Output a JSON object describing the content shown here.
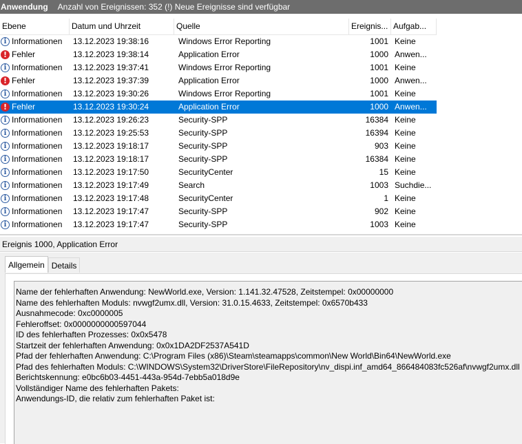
{
  "titlebar": {
    "app": "Anwendung",
    "info": "Anzahl von Ereignissen: 352 (!) Neue Ereignisse sind verfügbar"
  },
  "columns": [
    "Ebene",
    "Datum und Uhrzeit",
    "Quelle",
    "Ereignis...",
    "Aufgab..."
  ],
  "rows": [
    {
      "level": "Informationen",
      "icon": "info-icon",
      "datetime": "13.12.2023 19:38:16",
      "source": "Windows Error Reporting",
      "id": "1001",
      "task": "Keine"
    },
    {
      "level": "Fehler",
      "icon": "error-icon",
      "datetime": "13.12.2023 19:38:14",
      "source": "Application Error",
      "id": "1000",
      "task": "Anwen..."
    },
    {
      "level": "Informationen",
      "icon": "info-icon",
      "datetime": "13.12.2023 19:37:41",
      "source": "Windows Error Reporting",
      "id": "1001",
      "task": "Keine"
    },
    {
      "level": "Fehler",
      "icon": "error-icon",
      "datetime": "13.12.2023 19:37:39",
      "source": "Application Error",
      "id": "1000",
      "task": "Anwen..."
    },
    {
      "level": "Informationen",
      "icon": "info-icon",
      "datetime": "13.12.2023 19:30:26",
      "source": "Windows Error Reporting",
      "id": "1001",
      "task": "Keine"
    },
    {
      "level": "Fehler",
      "icon": "error-icon",
      "datetime": "13.12.2023 19:30:24",
      "source": "Application Error",
      "id": "1000",
      "task": "Anwen...",
      "selected": true
    },
    {
      "level": "Informationen",
      "icon": "info-icon",
      "datetime": "13.12.2023 19:26:23",
      "source": "Security-SPP",
      "id": "16384",
      "task": "Keine"
    },
    {
      "level": "Informationen",
      "icon": "info-icon",
      "datetime": "13.12.2023 19:25:53",
      "source": "Security-SPP",
      "id": "16394",
      "task": "Keine"
    },
    {
      "level": "Informationen",
      "icon": "info-icon",
      "datetime": "13.12.2023 19:18:17",
      "source": "Security-SPP",
      "id": "903",
      "task": "Keine"
    },
    {
      "level": "Informationen",
      "icon": "info-icon",
      "datetime": "13.12.2023 19:18:17",
      "source": "Security-SPP",
      "id": "16384",
      "task": "Keine"
    },
    {
      "level": "Informationen",
      "icon": "info-icon",
      "datetime": "13.12.2023 19:17:50",
      "source": "SecurityCenter",
      "id": "15",
      "task": "Keine"
    },
    {
      "level": "Informationen",
      "icon": "info-icon",
      "datetime": "13.12.2023 19:17:49",
      "source": "Search",
      "id": "1003",
      "task": "Suchdie..."
    },
    {
      "level": "Informationen",
      "icon": "info-icon",
      "datetime": "13.12.2023 19:17:48",
      "source": "SecurityCenter",
      "id": "1",
      "task": "Keine"
    },
    {
      "level": "Informationen",
      "icon": "info-icon",
      "datetime": "13.12.2023 19:17:47",
      "source": "Security-SPP",
      "id": "902",
      "task": "Keine"
    },
    {
      "level": "Informationen",
      "icon": "info-icon",
      "datetime": "13.12.2023 19:17:47",
      "source": "Security-SPP",
      "id": "1003",
      "task": "Keine"
    }
  ],
  "detail": {
    "header": "Ereignis 1000, Application Error",
    "tabs": [
      "Allgemein",
      "Details"
    ],
    "lines": [
      "Name der fehlerhaften Anwendung: NewWorld.exe, Version: 1.141.32.47528, Zeitstempel: 0x00000000",
      "Name des fehlerhaften Moduls: nvwgf2umx.dll, Version: 31.0.15.4633, Zeitstempel: 0x6570b433",
      "Ausnahmecode: 0xc0000005",
      "Fehleroffset: 0x0000000000597044",
      "ID des fehlerhaften Prozesses: 0x0x5478",
      "Startzeit der fehlerhaften Anwendung: 0x0x1DA2DF2537A541D",
      "Pfad der fehlerhaften Anwendung: C:\\Program Files (x86)\\Steam\\steamapps\\common\\New World\\Bin64\\NewWorld.exe",
      "Pfad des fehlerhaften Moduls: C:\\WINDOWS\\System32\\DriverStore\\FileRepository\\nv_dispi.inf_amd64_866484083fc526af\\nvwgf2umx.dll",
      "Berichtskennung: e0bc6b03-4451-443a-954d-7ebb5a018d9e",
      "Vollständiger Name des fehlerhaften Pakets:",
      "Anwendungs-ID, die relativ zum fehlerhaften Paket ist:"
    ]
  },
  "colors": {
    "selected": "#0078d7",
    "titlebar": "#6d6d6d",
    "error": "#d9242a",
    "info": "#2c5aa0"
  }
}
